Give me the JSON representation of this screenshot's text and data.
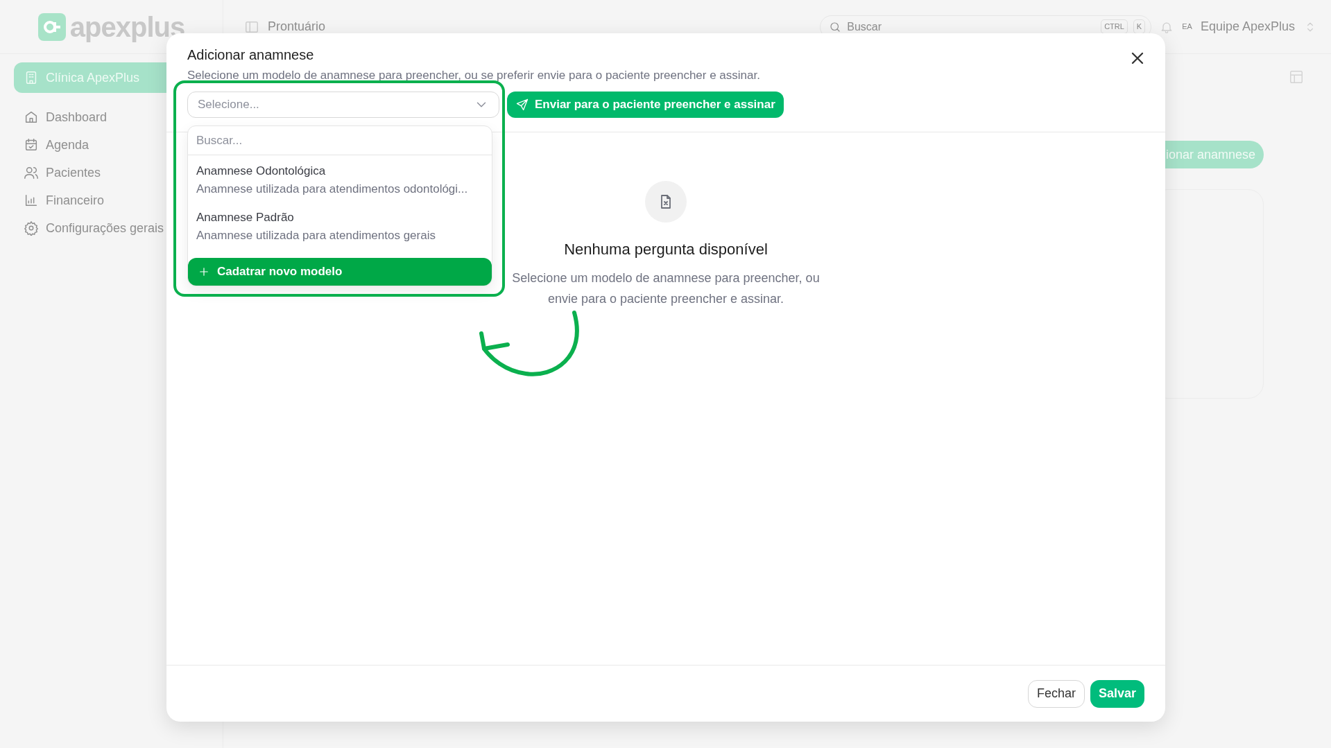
{
  "app": {
    "logo_text": "apexplus",
    "clinic": "Clínica ApexPlus"
  },
  "sidebar": {
    "items": [
      {
        "label": "Dashboard"
      },
      {
        "label": "Agenda"
      },
      {
        "label": "Pacientes"
      },
      {
        "label": "Financeiro"
      },
      {
        "label": "Configurações gerais"
      }
    ]
  },
  "topbar": {
    "page_title": "Prontuário",
    "search": {
      "placeholder": "Buscar",
      "shortcut": [
        "CTRL",
        "K"
      ]
    },
    "user": {
      "initials": "EA",
      "name": "Equipe ApexPlus"
    }
  },
  "page": {
    "add_button": "ionar anamnese"
  },
  "modal": {
    "title": "Adicionar anamnese",
    "subtitle": "Selecione um modelo de anamnese para preencher, ou se preferir envie para o paciente preencher e assinar.",
    "select": {
      "placeholder": "Selecione...",
      "expanded": true
    },
    "send_button": "Enviar para o paciente preencher e assinar",
    "dropdown": {
      "search_placeholder": "Buscar...",
      "options": [
        {
          "title": "Anamnese Odontológica",
          "description": "Anamnese utilizada para atendimentos odontológi...",
          "selected": false
        },
        {
          "title": "Anamnese Padrão",
          "description": "Anamnese utilizada para atendimentos gerais",
          "selected": false
        }
      ],
      "create_button": "Cadatrar novo modelo"
    },
    "empty_state": {
      "title": "Nenhuma pergunta disponível",
      "text": "Selecione um modelo de anamnese para preencher, ou envie para o paciente preencher e assinar."
    },
    "buttons": [
      {
        "label": "Fechar",
        "kind": "secondary"
      },
      {
        "label": "Salvar",
        "kind": "primary"
      }
    ]
  }
}
